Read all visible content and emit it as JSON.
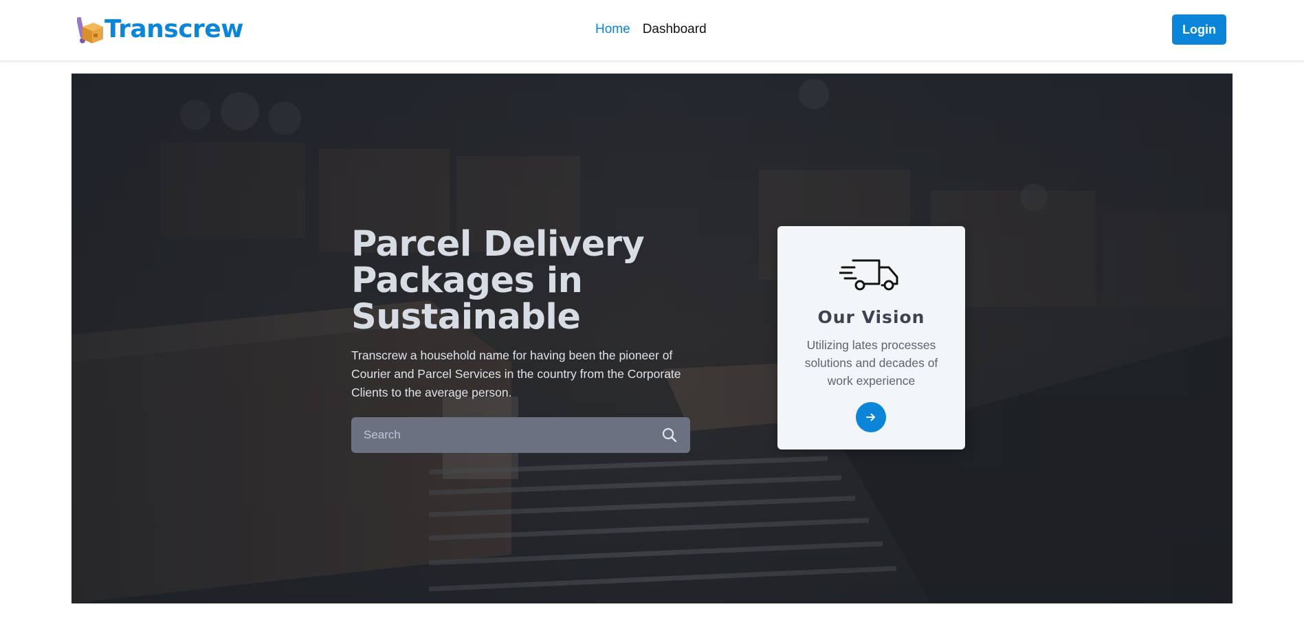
{
  "brand": {
    "name": "Transcrew",
    "color": "#0b85d8"
  },
  "nav": {
    "items": [
      {
        "label": "Home",
        "active": true
      },
      {
        "label": "Dashboard",
        "active": false
      }
    ],
    "login_label": "Login"
  },
  "hero": {
    "title": "Parcel Delivery Packages in Sustainable",
    "description": "Transcrew a household name for having been the pioneer of Courier and Parcel Services in the country from the Corporate Clients to the average person.",
    "search": {
      "placeholder": "Search",
      "value": "",
      "icon": "search-icon"
    },
    "background": "warehouse conveyor with parcels"
  },
  "vision_card": {
    "icon": "delivery-truck-icon",
    "title": "Our Vision",
    "text": "Utilizing lates processes solutions and decades of work experience",
    "button_icon": "arrow-right-icon"
  },
  "colors": {
    "accent": "#0b85d8",
    "hero_overlay": "#2a2c33",
    "card_bg": "#f3f6f9"
  }
}
